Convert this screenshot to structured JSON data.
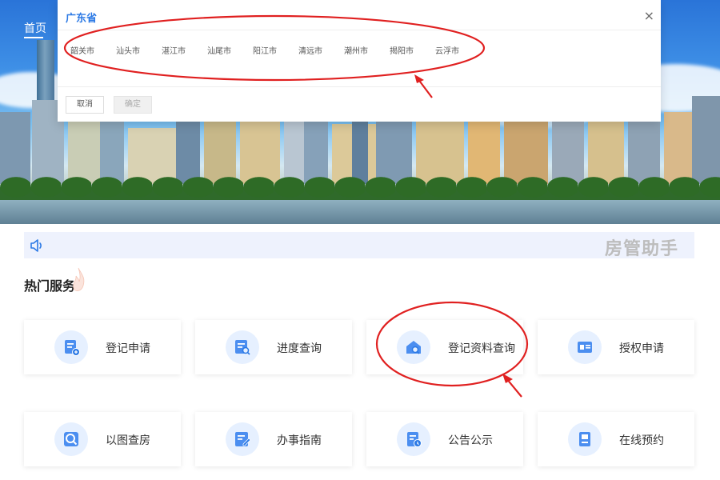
{
  "nav": {
    "home": "首页"
  },
  "city_picker": {
    "province": "广东省",
    "close": "×",
    "cities": [
      "韶关市",
      "汕头市",
      "湛江市",
      "汕尾市",
      "阳江市",
      "清远市",
      "潮州市",
      "揭阳市",
      "云浮市"
    ],
    "cancel": "取消",
    "confirm": "确定"
  },
  "notice": {
    "tag": "房管助手"
  },
  "hot_services": {
    "title": "热门服务",
    "items": [
      {
        "label": "登记申请",
        "icon": "apply-doc-icon"
      },
      {
        "label": "进度查询",
        "icon": "progress-search-icon"
      },
      {
        "label": "登记资料查询",
        "icon": "house-search-icon"
      },
      {
        "label": "授权申请",
        "icon": "id-card-icon"
      },
      {
        "label": "以图查房",
        "icon": "image-search-icon"
      },
      {
        "label": "办事指南",
        "icon": "guide-doc-icon"
      },
      {
        "label": "公告公示",
        "icon": "notice-doc-icon"
      },
      {
        "label": "在线预约",
        "icon": "appointment-icon"
      }
    ]
  },
  "colors": {
    "accent": "#2b79e5",
    "annotation": "#e02020",
    "icon_bg": "#e6f0ff"
  }
}
